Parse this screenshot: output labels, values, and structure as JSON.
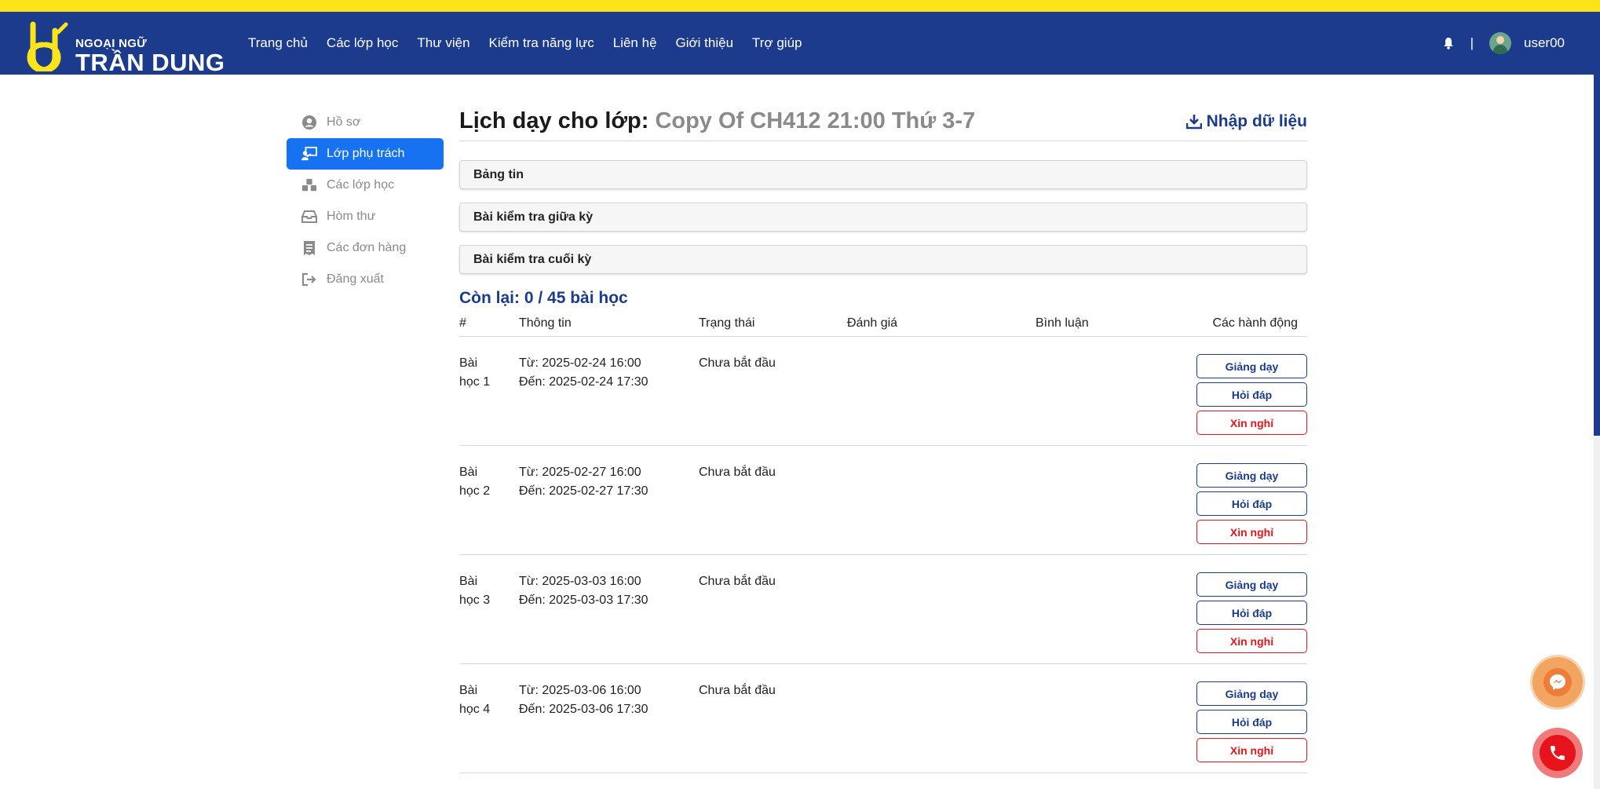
{
  "brand": {
    "small": "NGOẠI NGỮ",
    "big": "TRẦN DUNG",
    "color": "#fce41a"
  },
  "nav": {
    "items": [
      "Trang chủ",
      "Các lớp học",
      "Thư viện",
      "Kiểm tra năng lực",
      "Liên hệ",
      "Giới thiệu",
      "Trợ giúp"
    ],
    "separator": "|",
    "username": "user00",
    "bg": "#1c3b8c"
  },
  "sidebar": {
    "items": [
      {
        "label": "Hồ sơ",
        "icon": "user-circle-icon"
      },
      {
        "label": "Lớp phụ trách",
        "icon": "teacher-board-icon",
        "active": true
      },
      {
        "label": "Các lớp học",
        "icon": "cubes-icon"
      },
      {
        "label": "Hòm thư",
        "icon": "inbox-icon"
      },
      {
        "label": "Các đơn hàng",
        "icon": "receipt-icon"
      },
      {
        "label": "Đăng xuất",
        "icon": "sign-out-icon"
      }
    ]
  },
  "main": {
    "title_prefix": "Lịch dạy cho lớp:",
    "class_name": "Copy Of CH412 21:00 Thứ 3-7",
    "import_label": "Nhập dữ liệu",
    "panels": [
      "Bảng tin",
      "Bài kiểm tra giữa kỳ",
      "Bài kiểm tra cuối kỳ"
    ],
    "remaining": "Còn lại: 0 / 45 bài học",
    "columns": {
      "num": "#",
      "info": "Thông tin",
      "status": "Trạng thái",
      "rating": "Đánh giá",
      "comment": "Bình luận",
      "actions": "Các hành động"
    },
    "lessons": [
      {
        "num": "Bài học 1",
        "from": "Từ: 2025-02-24 16:00",
        "to": "Đến: 2025-02-24 17:30",
        "status": "Chưa bắt đầu"
      },
      {
        "num": "Bài học 2",
        "from": "Từ: 2025-02-27 16:00",
        "to": "Đến: 2025-02-27 17:30",
        "status": "Chưa bắt đầu"
      },
      {
        "num": "Bài học 3",
        "from": "Từ: 2025-03-03 16:00",
        "to": "Đến: 2025-03-03 17:30",
        "status": "Chưa bắt đầu"
      },
      {
        "num": "Bài học 4",
        "from": "Từ: 2025-03-06 16:00",
        "to": "Đến: 2025-03-06 17:30",
        "status": "Chưa bắt đầu"
      }
    ],
    "actions": {
      "teach": "Giảng dạy",
      "qa": "Hỏi đáp",
      "leave": "Xin nghỉ"
    }
  },
  "widgets": {
    "messenger_icon": "messenger-icon",
    "phone_icon": "phone-icon"
  }
}
